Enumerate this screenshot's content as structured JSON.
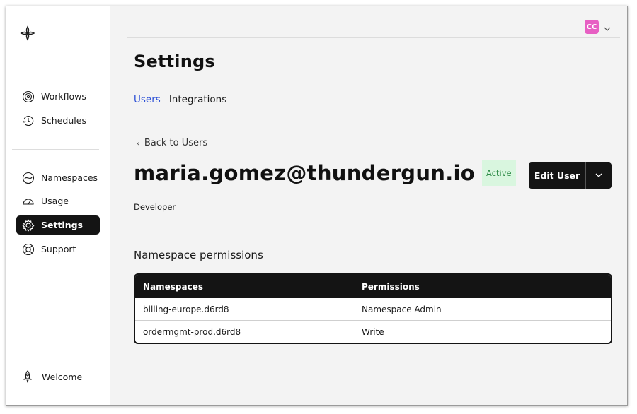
{
  "sidebar": {
    "logo_icon": "temporal-logo-icon",
    "nav_top": [
      {
        "label": "Workflows",
        "icon": "workflows-icon"
      },
      {
        "label": "Schedules",
        "icon": "schedules-icon"
      }
    ],
    "nav_bottom": [
      {
        "label": "Namespaces",
        "icon": "namespaces-icon"
      },
      {
        "label": "Usage",
        "icon": "usage-icon"
      },
      {
        "label": "Settings",
        "icon": "gear-icon",
        "active": true
      },
      {
        "label": "Support",
        "icon": "support-icon"
      }
    ],
    "welcome": {
      "label": "Welcome",
      "icon": "rocket-icon"
    }
  },
  "header": {
    "avatar_initials": "CC",
    "avatar_color": "#e75fc3"
  },
  "page": {
    "title": "Settings",
    "tabs": [
      {
        "label": "Users",
        "active": true
      },
      {
        "label": "Integrations",
        "active": false
      }
    ],
    "back_link": "Back to Users",
    "user_email": "maria.gomez@thundergun.io",
    "status_badge": "Active",
    "role": "Developer",
    "edit_button": "Edit User",
    "section_title": "Namespace permissions"
  },
  "permissions_table": {
    "columns": [
      "Namespaces",
      "Permissions"
    ],
    "rows": [
      {
        "namespace": "billing-europe.d6rd8",
        "permission": "Namespace Admin"
      },
      {
        "namespace": "ordermgmt-prod.d6rd8",
        "permission": "Write"
      }
    ]
  },
  "colors": {
    "accent": "#2b4fd6",
    "dark": "#141414",
    "badge_bg": "#d9f6df",
    "badge_text": "#2e8b47"
  }
}
